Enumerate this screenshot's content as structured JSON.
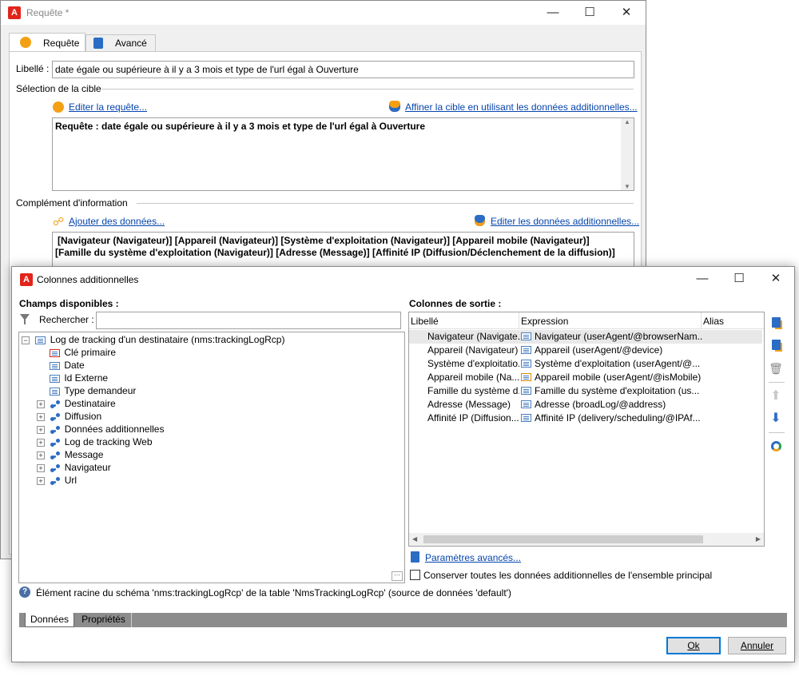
{
  "back_window": {
    "title": "Requête *",
    "tabs": [
      {
        "label": "Requête"
      },
      {
        "label": "Avancé"
      }
    ],
    "libelle_label": "Libellé :",
    "libelle_value": "date égale ou supérieure à il y a 3 mois et type de l'url égal à Ouverture",
    "target_section": "Sélection de la cible",
    "edit_query_link": "Editer la requête...",
    "refine_link": "Affiner la cible en utilisant les données additionnelles...",
    "query_text": "Requête : date égale ou supérieure à il y a 3 mois et type de l'url égal à Ouverture",
    "complement_section": "Complément d'information",
    "add_data_link": "Ajouter des données...",
    "edit_additional_link": "Editer les données additionnelles...",
    "data_text_line1": "[Navigateur (Navigateur)]  [Appareil (Navigateur)]  [Système d'exploitation (Navigateur)]  [Appareil mobile (Navigateur)]",
    "data_text_line2": "[Famille du système d'exploitation (Navigateur)]  [Adresse (Message)]  [Affinité IP (Diffusion/Déclenchement de la diffusion)]"
  },
  "dialog": {
    "title": "Colonnes additionnelles",
    "available_fields_label": "Champs disponibles :",
    "search_label": "Rechercher :",
    "search_value": "",
    "tree": {
      "root": "Log de tracking d'un destinataire (nms:trackingLogRcp)",
      "fields": [
        "Clé primaire",
        "Date",
        "Id Externe",
        "Type demandeur"
      ],
      "links": [
        "Destinataire",
        "Diffusion",
        "Données additionnelles",
        "Log de tracking Web",
        "Message",
        "Navigateur",
        "Url"
      ]
    },
    "output_columns_label": "Colonnes de sortie :",
    "grid_headers": {
      "libelle": "Libellé",
      "expression": "Expression",
      "alias": "Alias"
    },
    "grid_rows": [
      {
        "libelle": "Navigateur (Navigate...",
        "expression": "Navigateur (userAgent/@browserNam..."
      },
      {
        "libelle": "Appareil (Navigateur)",
        "expression": "Appareil (userAgent/@device)"
      },
      {
        "libelle": "Système d'exploitatio...",
        "expression": "Système d'exploitation (userAgent/@..."
      },
      {
        "libelle": "Appareil mobile (Na...",
        "expression": "Appareil mobile (userAgent/@isMobile)"
      },
      {
        "libelle": "Famille du système d...",
        "expression": "Famille du système d'exploitation (us..."
      },
      {
        "libelle": "Adresse (Message)",
        "expression": "Adresse (broadLog/@address)"
      },
      {
        "libelle": "Affinité IP (Diffusion...",
        "expression": "Affinité IP (delivery/scheduling/@IPAf..."
      }
    ],
    "advanced_params_link": "Paramètres avancés...",
    "keep_all_checkbox_label": "Conserver toutes les données additionnelles de l'ensemble principal",
    "keep_all_checked": false,
    "info_text": "Élément racine du schéma 'nms:trackingLogRcp' de la table 'NmsTrackingLogRcp' (source de données 'default')",
    "bottom_tabs": [
      {
        "label": "Données"
      },
      {
        "label": "Propriétés"
      }
    ],
    "ok_label": "Ok",
    "cancel_label": "Annuler"
  },
  "colors": {
    "accent_orange": "#f3a015",
    "link_blue": "#0645ad",
    "brand_red": "#e1251b",
    "selected_row": "#e8e8e8"
  }
}
